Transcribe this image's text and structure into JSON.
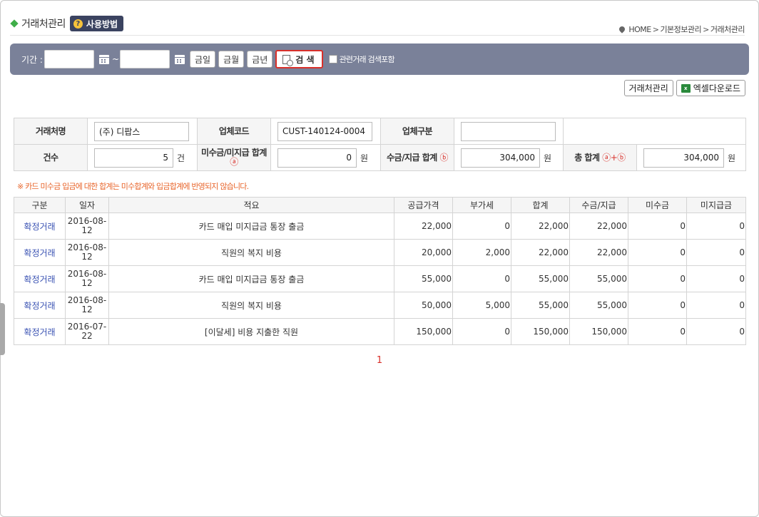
{
  "header": {
    "title": "거래처관리",
    "help_label": "사용방법",
    "help_icon": "?",
    "breadcrumb": [
      "HOME",
      "기본정보관리",
      "거래처관리"
    ],
    "breadcrumb_sep": ">"
  },
  "search": {
    "period_label": "기간 :",
    "date_from": "",
    "date_to": "",
    "range_sep": "~",
    "today_label": "금일",
    "month_label": "금월",
    "year_label": "금년",
    "search_label": "검 색",
    "related_label": "관련거래 검색포함"
  },
  "tools": {
    "manage_label": "거래처관리",
    "excel_label": "엑셀다운로드"
  },
  "summary": {
    "name_label": "거래처명",
    "name_value": "(주) 디팝스",
    "code_label": "업체코드",
    "code_value": "CUST-140124-0004",
    "type_label": "업체구분",
    "type_value": "",
    "count_label": "건수",
    "count_value": "5",
    "count_unit": "건",
    "unpaid_label": "미수금/미지급 합계",
    "unpaid_mark": "ⓐ",
    "unpaid_value": "0",
    "won": "원",
    "paid_label": "수금/지급 합계",
    "paid_mark": "ⓑ",
    "paid_value": "304,000",
    "total_label": "총 합계",
    "total_mark": "ⓐ+ⓑ",
    "total_value": "304,000"
  },
  "notice": "※ 카드 미수금 입금에 대한 합계는 미수합계와 입금합계에 반영되지 않습니다.",
  "table": {
    "headers": [
      "구분",
      "일자",
      "적요",
      "공급가격",
      "부가세",
      "합계",
      "수금/지급",
      "미수금",
      "미지급금"
    ],
    "rows": [
      {
        "type": "확정거래",
        "date": "2016-08-12",
        "memo": "카드 매입 미지급금 통장 출금",
        "supply": "22,000",
        "vat": "0",
        "sum": "22,000",
        "paid": "22,000",
        "unpaid": "0",
        "payable": "0"
      },
      {
        "type": "확정거래",
        "date": "2016-08-12",
        "memo": "직원의 복지 비용",
        "supply": "20,000",
        "vat": "2,000",
        "sum": "22,000",
        "paid": "22,000",
        "unpaid": "0",
        "payable": "0"
      },
      {
        "type": "확정거래",
        "date": "2016-08-12",
        "memo": "카드 매입 미지급금 통장 출금",
        "supply": "55,000",
        "vat": "0",
        "sum": "55,000",
        "paid": "55,000",
        "unpaid": "0",
        "payable": "0"
      },
      {
        "type": "확정거래",
        "date": "2016-08-12",
        "memo": "직원의 복지 비용",
        "supply": "50,000",
        "vat": "5,000",
        "sum": "55,000",
        "paid": "55,000",
        "unpaid": "0",
        "payable": "0"
      },
      {
        "type": "확정거래",
        "date": "2016-07-22",
        "memo": "[이달세] 비용 지출한 직원",
        "supply": "150,000",
        "vat": "0",
        "sum": "150,000",
        "paid": "150,000",
        "unpaid": "0",
        "payable": "0"
      }
    ]
  },
  "pagination": {
    "current": "1"
  }
}
